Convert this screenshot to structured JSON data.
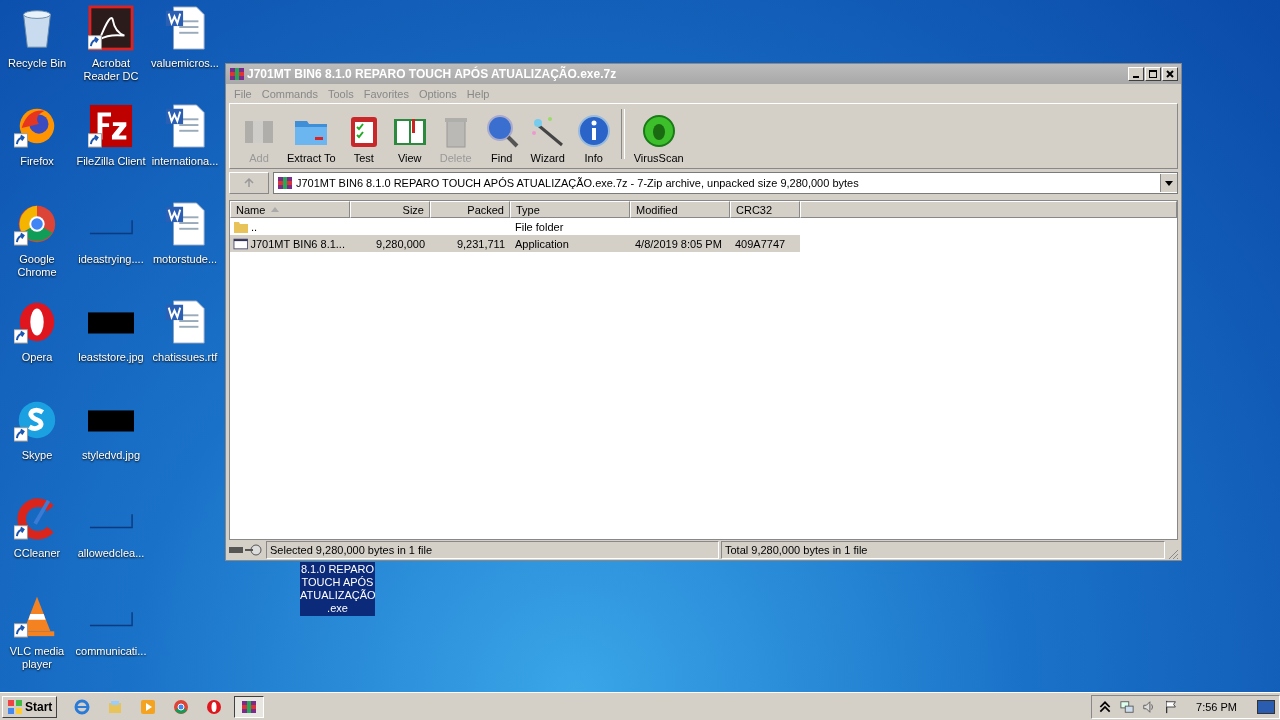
{
  "desktop": {
    "icons": [
      {
        "label": "Recycle Bin",
        "kind": "recycle",
        "shortcut": false
      },
      {
        "label": "Firefox",
        "kind": "firefox",
        "shortcut": true
      },
      {
        "label": "Google Chrome",
        "kind": "chrome",
        "shortcut": true
      },
      {
        "label": "Opera",
        "kind": "opera",
        "shortcut": true
      },
      {
        "label": "Skype",
        "kind": "skype",
        "shortcut": true
      },
      {
        "label": "CCleaner",
        "kind": "ccleaner",
        "shortcut": true
      },
      {
        "label": "VLC media player",
        "kind": "vlc",
        "shortcut": true
      },
      {
        "label": "Acrobat Reader DC",
        "kind": "acrobat",
        "shortcut": true
      },
      {
        "label": "FileZilla Client",
        "kind": "filezilla",
        "shortcut": true
      },
      {
        "label": "ideastrying....",
        "kind": "blank-image",
        "shortcut": false
      },
      {
        "label": "leaststore.jpg",
        "kind": "dark-image",
        "shortcut": false
      },
      {
        "label": "styledvd.jpg",
        "kind": "dark-image",
        "shortcut": false
      },
      {
        "label": "allowedclea...",
        "kind": "blank-image",
        "shortcut": false
      },
      {
        "label": "communicati...",
        "kind": "blank-image",
        "shortcut": false
      },
      {
        "label": "valuemicros...",
        "kind": "word",
        "shortcut": false
      },
      {
        "label": "internationa...",
        "kind": "word",
        "shortcut": false
      },
      {
        "label": "motorstude...",
        "kind": "word",
        "shortcut": false
      },
      {
        "label": "chatissues.rtf",
        "kind": "word",
        "shortcut": false
      }
    ],
    "drag_label": "8.1.0 REPARO TOUCH APÓS ATUALIZAÇÃO .exe"
  },
  "window": {
    "title": "J701MT BIN6 8.1.0 REPARO TOUCH APÓS ATUALIZAÇÃO.exe.7z",
    "menu": [
      "File",
      "Commands",
      "Tools",
      "Favorites",
      "Options",
      "Help"
    ],
    "toolbar": [
      {
        "label": "Add",
        "kind": "add",
        "disabled": true
      },
      {
        "label": "Extract To",
        "kind": "extract",
        "disabled": false
      },
      {
        "label": "Test",
        "kind": "test",
        "disabled": false
      },
      {
        "label": "View",
        "kind": "view",
        "disabled": false
      },
      {
        "label": "Delete",
        "kind": "delete",
        "disabled": true
      },
      {
        "label": "Find",
        "kind": "find",
        "disabled": false
      },
      {
        "label": "Wizard",
        "kind": "wizard",
        "disabled": false
      },
      {
        "label": "Info",
        "kind": "info",
        "disabled": false
      },
      {
        "label": "VirusScan",
        "kind": "virus",
        "disabled": false
      }
    ],
    "address": "J701MT BIN6 8.1.0 REPARO TOUCH APÓS ATUALIZAÇÃO.exe.7z - 7-Zip archive, unpacked size 9,280,000 bytes",
    "columns": [
      "Name",
      "Size",
      "Packed",
      "Type",
      "Modified",
      "CRC32"
    ],
    "rows": [
      {
        "kind": "folder",
        "name": "..",
        "size": "",
        "packed": "",
        "type": "File folder",
        "modified": "",
        "crc": "",
        "selected": false
      },
      {
        "kind": "app",
        "name": "J701MT BIN6 8.1...",
        "size": "9,280,000",
        "packed": "9,231,711",
        "type": "Application",
        "modified": "4/8/2019 8:05 PM",
        "crc": "409A7747",
        "selected": true
      }
    ],
    "status": [
      "Selected 9,280,000 bytes in 1 file",
      "Total 9,280,000 bytes in 1 file"
    ]
  },
  "taskbar": {
    "start": "Start",
    "apps": [
      {
        "kind": "ie",
        "active": false
      },
      {
        "kind": "explorer",
        "active": false
      },
      {
        "kind": "media",
        "active": false
      },
      {
        "kind": "chrome",
        "active": false
      },
      {
        "kind": "opera",
        "active": false
      },
      {
        "kind": "winrar",
        "active": true
      }
    ],
    "clock": "7:56 PM"
  }
}
